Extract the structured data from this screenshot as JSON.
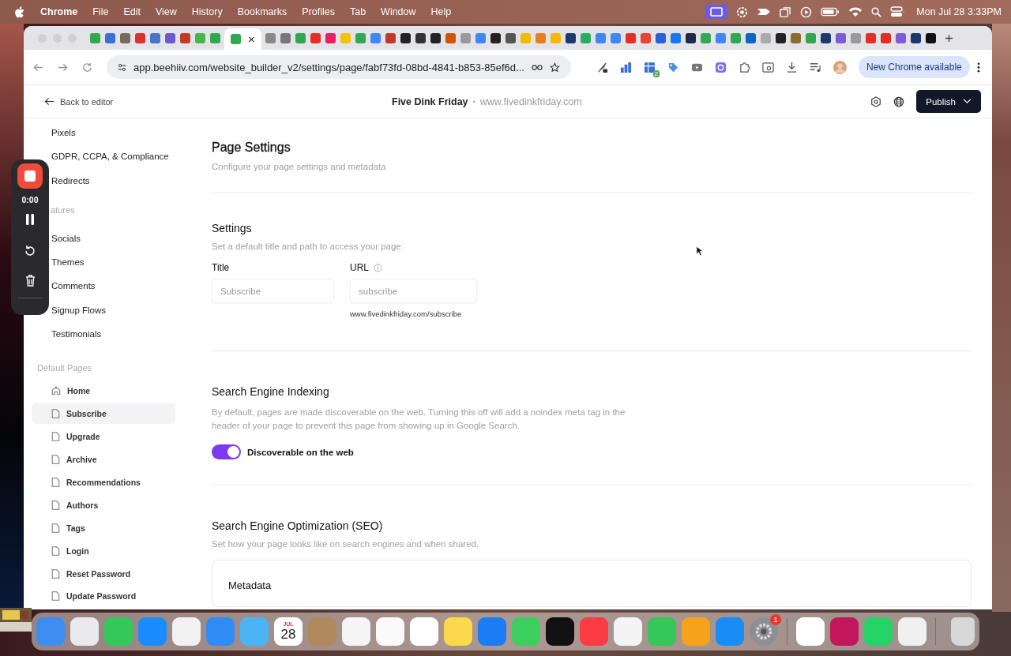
{
  "menu_bar": {
    "app": "Chrome",
    "items": [
      "File",
      "Edit",
      "View",
      "History",
      "Bookmarks",
      "Profiles",
      "Tab",
      "Window",
      "Help"
    ],
    "clock": "Mon Jul 28  3:33PM"
  },
  "tabs": [
    {
      "color": "#2fa84f",
      "selected": false
    },
    {
      "color": "#3b6fd8",
      "selected": false
    },
    {
      "color": "#7a6a5a",
      "selected": false
    },
    {
      "color": "#d8312e",
      "selected": false
    },
    {
      "color": "#4a73c9",
      "selected": false
    },
    {
      "color": "#6a5acd",
      "selected": false
    },
    {
      "color": "#c0392b",
      "selected": false
    },
    {
      "color": "#45b649",
      "selected": false
    },
    {
      "color": "#2fa84f",
      "selected": false
    },
    {
      "color": "#2fa84f",
      "selected": true,
      "close": "×"
    },
    {
      "color": "#888888",
      "selected": false
    },
    {
      "color": "#777777",
      "selected": false
    },
    {
      "color": "#2fa84f",
      "selected": false
    },
    {
      "color": "#e52d27",
      "selected": false
    },
    {
      "color": "#e91e63",
      "selected": false
    },
    {
      "color": "#f4c20d",
      "selected": false
    },
    {
      "color": "#2fa84f",
      "selected": false
    },
    {
      "color": "#4285f4",
      "selected": false
    },
    {
      "color": "#c0392b",
      "selected": false
    },
    {
      "color": "#222222",
      "selected": false
    },
    {
      "color": "#333333",
      "selected": false
    },
    {
      "color": "#222222",
      "selected": false
    },
    {
      "color": "#d35400",
      "selected": false
    },
    {
      "color": "#999999",
      "selected": false
    },
    {
      "color": "#4285f4",
      "selected": false
    },
    {
      "color": "#222222",
      "selected": false
    },
    {
      "color": "#555555",
      "selected": false
    },
    {
      "color": "#f5b800",
      "selected": false
    },
    {
      "color": "#e67e22",
      "selected": false
    },
    {
      "color": "#f5b800",
      "selected": false
    },
    {
      "color": "#1b3a6b",
      "selected": false
    },
    {
      "color": "#27ae60",
      "selected": false
    },
    {
      "color": "#4285f4",
      "selected": false
    },
    {
      "color": "#4285f4",
      "selected": false
    },
    {
      "color": "#e52d27",
      "selected": false
    },
    {
      "color": "#ea4335",
      "selected": false
    },
    {
      "color": "#2b5fd9",
      "selected": false
    },
    {
      "color": "#1877f2",
      "selected": false
    },
    {
      "color": "#1b2a4a",
      "selected": false
    },
    {
      "color": "#34a853",
      "selected": false
    },
    {
      "color": "#4285f4",
      "selected": false
    },
    {
      "color": "#2fa84f",
      "selected": false
    },
    {
      "color": "#0a66c2",
      "selected": false
    },
    {
      "color": "#aaaaaa",
      "selected": false
    },
    {
      "color": "#222222",
      "selected": false
    },
    {
      "color": "#8b6d2f",
      "selected": false
    },
    {
      "color": "#2fa84f",
      "selected": false
    },
    {
      "color": "#1b3a6b",
      "selected": false
    },
    {
      "color": "#7b5cd6",
      "selected": false
    },
    {
      "color": "#999999",
      "selected": false
    },
    {
      "color": "#e52d27",
      "selected": false
    },
    {
      "color": "#e52d27",
      "selected": false
    },
    {
      "color": "#7b5cd6",
      "selected": false
    },
    {
      "color": "#1b3a6b",
      "selected": false
    },
    {
      "color": "#111111",
      "selected": false
    }
  ],
  "address_bar": {
    "url": "app.beehiiv.com/website_builder_v2/settings/page/fabf73fd-08bd-4841-b853-85ef6d...",
    "extension_badge": "2",
    "update_button": "New Chrome available"
  },
  "header": {
    "back": "Back to editor",
    "site_name": "Five Dink Friday",
    "separator": "•",
    "site_url": "www.fivedinkfriday.com",
    "publish": "Publish"
  },
  "sidebar": {
    "top_items": [
      "Pixels",
      "GDPR, CCPA, & Compliance",
      "Redirects"
    ],
    "features_heading": "atures",
    "feature_items": [
      "Socials",
      "Themes",
      "Comments",
      "Signup Flows",
      "Testimonials"
    ],
    "pages_heading": "Default Pages",
    "pages": [
      {
        "label": "Home",
        "kind": "home",
        "selected": false
      },
      {
        "label": "Subscribe",
        "kind": "page",
        "selected": true
      },
      {
        "label": "Upgrade",
        "kind": "page",
        "selected": false
      },
      {
        "label": "Archive",
        "kind": "page",
        "selected": false
      },
      {
        "label": "Recommendations",
        "kind": "page",
        "selected": false
      },
      {
        "label": "Authors",
        "kind": "page",
        "selected": false
      },
      {
        "label": "Tags",
        "kind": "page",
        "selected": false
      },
      {
        "label": "Login",
        "kind": "page",
        "selected": false
      },
      {
        "label": "Reset Password",
        "kind": "page",
        "selected": false
      },
      {
        "label": "Update Password",
        "kind": "page",
        "selected": false
      }
    ]
  },
  "page_settings": {
    "title": "Page Settings",
    "subtitle": "Configure your page settings and metadata"
  },
  "settings": {
    "title": "Settings",
    "subtitle": "Set a default title and path to access your page",
    "title_label": "Title",
    "title_placeholder": "Subscribe",
    "url_label": "URL",
    "url_placeholder": "subscribe",
    "url_preview": "www.fivedinkfriday.com/subscribe"
  },
  "indexing": {
    "title": "Search Engine Indexing",
    "description": "By default, pages are made discoverable on the web. Turning this off will add a noindex meta tag in the header of your page to prevent this page from showing up in Google Search.",
    "toggle_label": "Discoverable on the web",
    "on": true
  },
  "seo": {
    "title": "Search Engine Optimization (SEO)",
    "subtitle": "Set how your page looks like on search engines and when shared.",
    "card_title": "Metadata"
  },
  "recorder": {
    "time": "0:00"
  },
  "dock": [
    {
      "kind": "app"
    },
    {
      "kind": "app"
    },
    {
      "kind": "app"
    },
    {
      "kind": "app"
    },
    {
      "kind": "app"
    },
    {
      "kind": "app"
    },
    {
      "kind": "app"
    },
    {
      "kind": "calendar",
      "month": "JUL",
      "day": "28"
    },
    {
      "kind": "app"
    },
    {
      "kind": "app"
    },
    {
      "kind": "app"
    },
    {
      "kind": "app"
    },
    {
      "kind": "app"
    },
    {
      "kind": "app"
    },
    {
      "kind": "app"
    },
    {
      "kind": "app"
    },
    {
      "kind": "app"
    },
    {
      "kind": "app"
    },
    {
      "kind": "app"
    },
    {
      "kind": "app"
    },
    {
      "kind": "app"
    },
    {
      "kind": "badge",
      "badge": "1"
    },
    {
      "kind": "divider"
    },
    {
      "kind": "app"
    },
    {
      "kind": "app"
    },
    {
      "kind": "app"
    },
    {
      "kind": "app"
    },
    {
      "kind": "divider"
    },
    {
      "kind": "trash"
    }
  ]
}
